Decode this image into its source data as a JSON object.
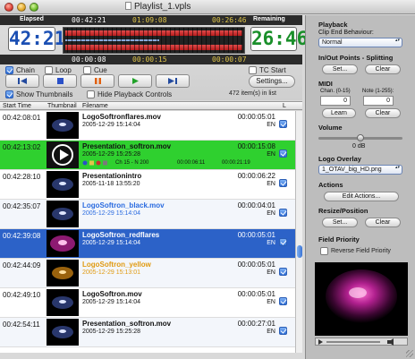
{
  "window": {
    "title": "Playlist_1.vpls"
  },
  "transport": {
    "elapsed_label": "Elapsed",
    "remaining_label": "Remaining",
    "elapsed_time": "42:21",
    "remaining_time": "26:46",
    "strip_left": "00:42:21",
    "strip_center": "01:09:08",
    "strip_right": "00:26:46",
    "strip2_left": "00:00:08",
    "strip2_center": "00:00:15",
    "strip2_right": "00:00:07",
    "progress_fraction": 0.53,
    "options": {
      "chain": "Chain",
      "loop": "Loop",
      "cue": "Cue",
      "tc_start": "TC Start"
    },
    "settings_label": "Settings...",
    "show_thumbnails": "Show Thumbnails",
    "hide_playback_controls": "Hide Playback Controls",
    "items_count": "472 item(s) in list",
    "colors": {
      "elapsed": "#1b4fb3",
      "remaining": "#1a8f2a",
      "play": "#22a22a",
      "stop": "#2a50c8",
      "pause": "#e06010"
    }
  },
  "table": {
    "columns": [
      "Start Time",
      "Thumbnail",
      "Filename",
      "L"
    ],
    "rows": [
      {
        "start": "00:42:08:01",
        "name": "LogoSoftronflares.mov",
        "date": "2005-12-29  15:14:04",
        "duration": "00:00:05:01",
        "lang": "EN",
        "state": "normal"
      },
      {
        "start": "00:42:13:02",
        "name": "Presentation_softron.mov",
        "date": "2005-12-29  15:25:28",
        "duration": "00:00:15:08",
        "lang": "EN",
        "info": "Ch 15 - N 200",
        "tc_in": "00:00:06:11",
        "tc_out": "00:00:21:19",
        "state": "playing"
      },
      {
        "start": "00:42:28:10",
        "name": "Presentationintro",
        "date": "2005-11-18  13:55:20",
        "duration": "00:00:06:22",
        "lang": "EN",
        "state": "normal"
      },
      {
        "start": "00:42:35:07",
        "name": "LogoSoftron_black.mov",
        "date": "2005-12-29  15:14:04",
        "duration": "00:00:04:01",
        "lang": "EN",
        "state": "blue"
      },
      {
        "start": "00:42:39:08",
        "name": "LogoSoftron_redflares",
        "date": "2005-12-29  15:14:04",
        "duration": "00:00:05:01",
        "lang": "EN",
        "state": "selected"
      },
      {
        "start": "00:42:44:09",
        "name": "LogoSoftron_yellow",
        "date": "2005-12-29  15:13:01",
        "duration": "00:00:05:01",
        "lang": "EN",
        "state": "orange"
      },
      {
        "start": "00:42:49:10",
        "name": "LogoSoftron.mov",
        "date": "2005-12-29  15:14:04",
        "duration": "00:00:05:01",
        "lang": "EN",
        "state": "normal"
      },
      {
        "start": "00:42:54:11",
        "name": "Presentation_softron.mov",
        "date": "2005-12-29  15:25:28",
        "duration": "00:00:27:01",
        "lang": "EN",
        "state": "normal"
      }
    ]
  },
  "inspector": {
    "playback_title": "Playback",
    "clip_end_label": "Clip End Behaviour:",
    "clip_end_value": "Normal",
    "inout_title": "In/Out Points - Splitting",
    "set_label": "Set...",
    "clear_label": "Clear",
    "midi_title": "MIDI",
    "chan_label": "Chan. (0-15)",
    "chan_value": "0",
    "note_label": "Note (1-255):",
    "note_value": "0",
    "learn_label": "Learn",
    "volume_title": "Volume",
    "volume_value": "0 dB",
    "volume_level": 0.5,
    "logo_title": "Logo Overlay",
    "logo_value": "1_OTAV_big_HD.png",
    "actions_title": "Actions",
    "edit_actions_label": "Edit Actions...",
    "resize_title": "Resize/Position",
    "field_title": "Field Priority",
    "reverse_field_label": "Reverse Field Priority"
  }
}
